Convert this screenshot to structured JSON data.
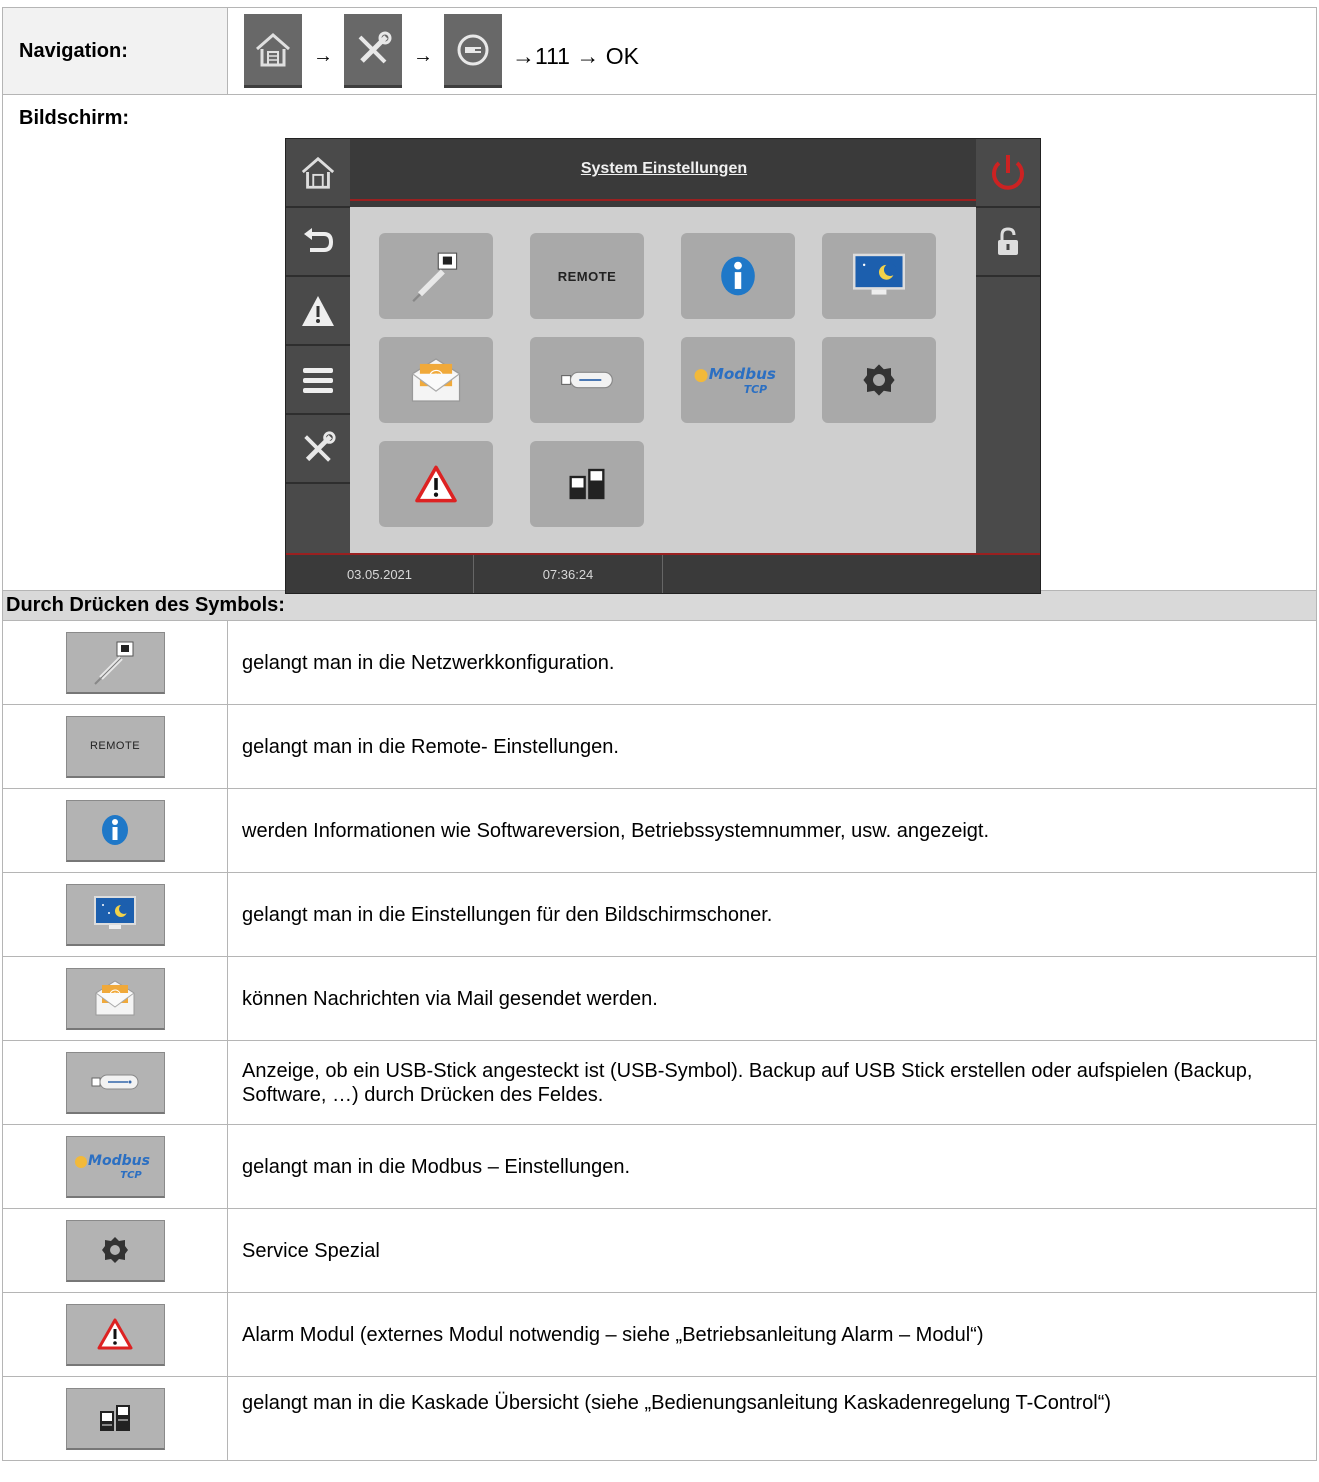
{
  "navigation": {
    "label": "Navigation:",
    "arrow": "→",
    "suffix": "→111 → OK"
  },
  "screen_label": "Bildschirm:",
  "device": {
    "title": "System Einstellungen",
    "date": "03.05.2021",
    "time": "07:36:24",
    "tile_remote_label": "REMOTE",
    "accent_color": "#cc2222"
  },
  "section_header": "Durch Drücken des Symbols:",
  "items": [
    {
      "icon": "network-icon",
      "text": "gelangt man in die Netzwerkkonfiguration."
    },
    {
      "icon": "remote-icon",
      "icon_label": "REMOTE",
      "text": "gelangt man in die Remote- Einstellungen."
    },
    {
      "icon": "info-icon",
      "text": "werden Informationen wie Softwareversion, Betriebssystemnummer, usw. angezeigt."
    },
    {
      "icon": "screensaver-icon",
      "text": "gelangt man in die Einstellungen für den Bildschirmschoner."
    },
    {
      "icon": "mail-icon",
      "text": "können Nachrichten via Mail gesendet werden."
    },
    {
      "icon": "usb-icon",
      "text": "Anzeige, ob ein USB-Stick angesteckt ist (USB-Symbol). Backup auf USB Stick erstellen oder aufspielen (Backup, Software, …) durch Drücken des Feldes."
    },
    {
      "icon": "modbus-icon",
      "text": "gelangt man in die Modbus – Einstellungen."
    },
    {
      "icon": "gear-icon",
      "text": "Service Spezial"
    },
    {
      "icon": "alarm-icon",
      "text": "Alarm Modul (externes Modul notwendig – siehe „Betriebsanleitung Alarm – Modul“)"
    },
    {
      "icon": "cascade-icon",
      "text": "gelangt man in die Kaskade Übersicht (siehe „Bedienungsanleitung Kaskadenregelung T-Control“)"
    }
  ]
}
